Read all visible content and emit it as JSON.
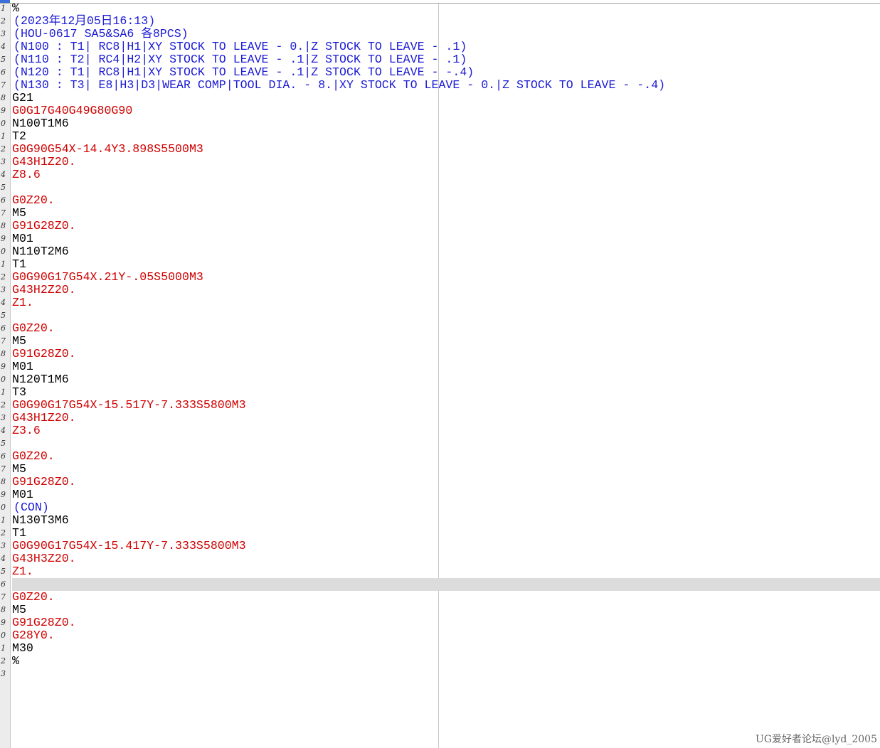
{
  "editor": {
    "colors": {
      "comment": "#1a1ad6",
      "motion": "#d00000",
      "default": "#000000",
      "highlight": "#dcdcdc"
    },
    "highlighted_line": 46,
    "lines": [
      {
        "n": "1",
        "text": "%",
        "style": "black"
      },
      {
        "n": "2",
        "text": "(2023年12月05日16:13)",
        "style": "blue"
      },
      {
        "n": "3",
        "text": "(HOU-0617 SA5&SA6 各8PCS)",
        "style": "blue"
      },
      {
        "n": "4",
        "text": "(N100 : T1| RC8|H1|XY STOCK TO LEAVE - 0.|Z STOCK TO LEAVE - .1)",
        "style": "blue"
      },
      {
        "n": "5",
        "text": "(N110 : T2| RC4|H2|XY STOCK TO LEAVE - .1|Z STOCK TO LEAVE - .1)",
        "style": "blue"
      },
      {
        "n": "6",
        "text": "(N120 : T1| RC8|H1|XY STOCK TO LEAVE - .1|Z STOCK TO LEAVE - -.4)",
        "style": "blue"
      },
      {
        "n": "7",
        "text": "(N130 : T3| E8|H3|D3|WEAR COMP|TOOL DIA. - 8.|XY STOCK TO LEAVE - 0.|Z STOCK TO LEAVE - -.4)",
        "style": "blue"
      },
      {
        "n": "8",
        "text": "G21",
        "style": "black"
      },
      {
        "n": "9",
        "text": "G0G17G40G49G80G90",
        "style": "red"
      },
      {
        "n": "0",
        "text": "N100T1M6",
        "style": "black"
      },
      {
        "n": "1",
        "text": "T2",
        "style": "black"
      },
      {
        "n": "2",
        "text": "G0G90G54X-14.4Y3.898S5500M3",
        "style": "red"
      },
      {
        "n": "3",
        "text": "G43H1Z20.",
        "style": "red"
      },
      {
        "n": "4",
        "text": "Z8.6",
        "style": "red"
      },
      {
        "n": "5",
        "text": "",
        "style": "black"
      },
      {
        "n": "6",
        "text": "G0Z20.",
        "style": "red"
      },
      {
        "n": "7",
        "text": "M5",
        "style": "black"
      },
      {
        "n": "8",
        "text": "G91G28Z0.",
        "style": "red"
      },
      {
        "n": "9",
        "text": "M01",
        "style": "black"
      },
      {
        "n": "0",
        "text": "N110T2M6",
        "style": "black"
      },
      {
        "n": "1",
        "text": "T1",
        "style": "black"
      },
      {
        "n": "2",
        "text": "G0G90G17G54X.21Y-.05S5000M3",
        "style": "red"
      },
      {
        "n": "3",
        "text": "G43H2Z20.",
        "style": "red"
      },
      {
        "n": "4",
        "text": "Z1.",
        "style": "red"
      },
      {
        "n": "5",
        "text": "",
        "style": "black"
      },
      {
        "n": "6",
        "text": "G0Z20.",
        "style": "red"
      },
      {
        "n": "7",
        "text": "M5",
        "style": "black"
      },
      {
        "n": "8",
        "text": "G91G28Z0.",
        "style": "red"
      },
      {
        "n": "9",
        "text": "M01",
        "style": "black"
      },
      {
        "n": "0",
        "text": "N120T1M6",
        "style": "black"
      },
      {
        "n": "1",
        "text": "T3",
        "style": "black"
      },
      {
        "n": "2",
        "text": "G0G90G17G54X-15.517Y-7.333S5800M3",
        "style": "red"
      },
      {
        "n": "3",
        "text": "G43H1Z20.",
        "style": "red"
      },
      {
        "n": "4",
        "text": "Z3.6",
        "style": "red"
      },
      {
        "n": "5",
        "text": "",
        "style": "black"
      },
      {
        "n": "6",
        "text": "G0Z20.",
        "style": "red"
      },
      {
        "n": "7",
        "text": "M5",
        "style": "black"
      },
      {
        "n": "8",
        "text": "G91G28Z0.",
        "style": "red"
      },
      {
        "n": "9",
        "text": "M01",
        "style": "black"
      },
      {
        "n": "0",
        "text": "(CON)",
        "style": "blue"
      },
      {
        "n": "1",
        "text": "N130T3M6",
        "style": "black"
      },
      {
        "n": "2",
        "text": "T1",
        "style": "black"
      },
      {
        "n": "3",
        "text": "G0G90G17G54X-15.417Y-7.333S5800M3",
        "style": "red"
      },
      {
        "n": "4",
        "text": "G43H3Z20.",
        "style": "red"
      },
      {
        "n": "5",
        "text": "Z1.",
        "style": "red"
      },
      {
        "n": "6",
        "text": "",
        "style": "black"
      },
      {
        "n": "7",
        "text": "G0Z20.",
        "style": "red"
      },
      {
        "n": "8",
        "text": "M5",
        "style": "black"
      },
      {
        "n": "9",
        "text": "G91G28Z0.",
        "style": "red"
      },
      {
        "n": "0",
        "text": "G28Y0.",
        "style": "red"
      },
      {
        "n": "1",
        "text": "M30",
        "style": "black"
      },
      {
        "n": "2",
        "text": "%",
        "style": "black"
      },
      {
        "n": "3",
        "text": "",
        "style": "black"
      }
    ]
  },
  "watermark": "UG爱好者论坛@lyd_2005"
}
